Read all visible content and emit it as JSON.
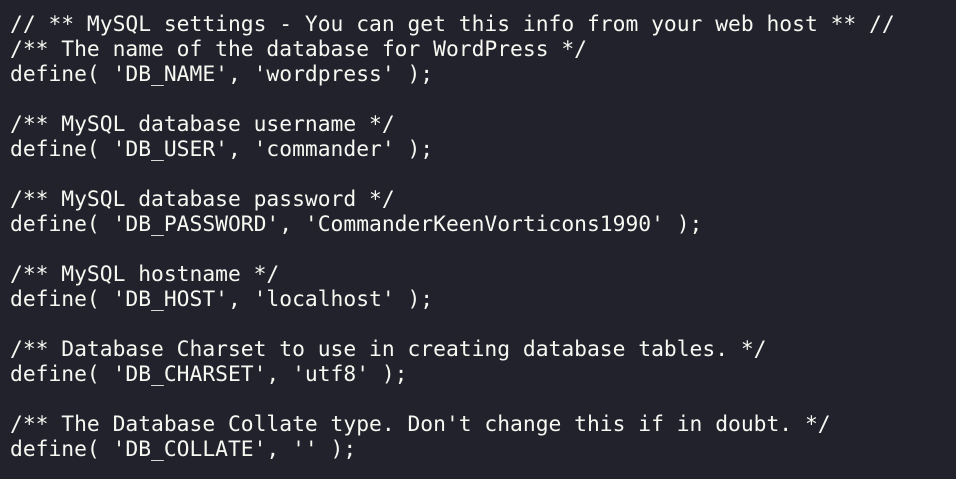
{
  "code_lines": [
    "// ** MySQL settings - You can get this info from your web host ** //",
    "/** The name of the database for WordPress */",
    "define( 'DB_NAME', 'wordpress' );",
    "",
    "/** MySQL database username */",
    "define( 'DB_USER', 'commander' );",
    "",
    "/** MySQL database password */",
    "define( 'DB_PASSWORD', 'CommanderKeenVorticons1990' );",
    "",
    "/** MySQL hostname */",
    "define( 'DB_HOST', 'localhost' );",
    "",
    "/** Database Charset to use in creating database tables. */",
    "define( 'DB_CHARSET', 'utf8' );",
    "",
    "/** The Database Collate type. Don't change this if in doubt. */",
    "define( 'DB_COLLATE', '' );"
  ]
}
